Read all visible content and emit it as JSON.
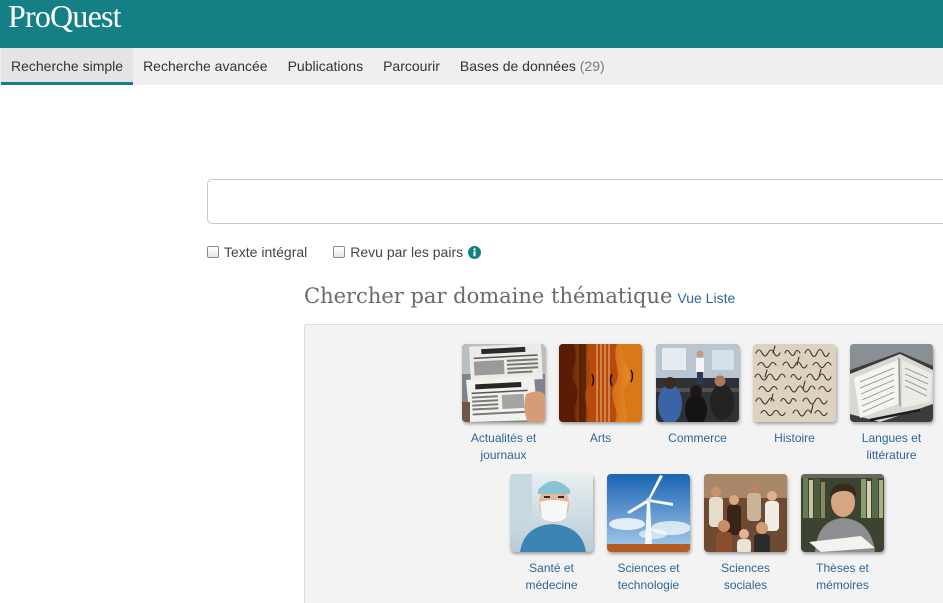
{
  "theme": {
    "accent": "#148085",
    "link": "#2e6699",
    "nav_bg": "#efefef"
  },
  "header": {
    "logo": "ProQuest"
  },
  "nav": {
    "tabs": [
      {
        "label": "Recherche simple",
        "active": true
      },
      {
        "label": "Recherche avancée",
        "active": false
      },
      {
        "label": "Publications",
        "active": false
      },
      {
        "label": "Parcourir",
        "active": false
      },
      {
        "label": "Bases de données",
        "count": "(29)",
        "active": false
      }
    ]
  },
  "search": {
    "query": ""
  },
  "filters": [
    {
      "label": "Texte intégral",
      "checked": false
    },
    {
      "label": "Revu par les pairs",
      "checked": false,
      "icon": "info-icon"
    }
  ],
  "subjects": {
    "heading": "Chercher par domaine thématique",
    "list_view_link": "Vue Liste",
    "items": [
      {
        "label": "Actualités et journaux",
        "icon": "newspapers-image"
      },
      {
        "label": "Arts",
        "icon": "violins-image"
      },
      {
        "label": "Commerce",
        "icon": "business-meeting-image"
      },
      {
        "label": "Histoire",
        "icon": "manuscript-image"
      },
      {
        "label": "Langues et littérature",
        "icon": "open-books-image"
      },
      {
        "label": "Santé et médecine",
        "icon": "surgeon-image"
      },
      {
        "label": "Sciences et technologie",
        "icon": "wind-turbine-image"
      },
      {
        "label": "Sciences sociales",
        "icon": "crowd-image"
      },
      {
        "label": "Thèses et mémoires",
        "icon": "student-image"
      }
    ]
  }
}
